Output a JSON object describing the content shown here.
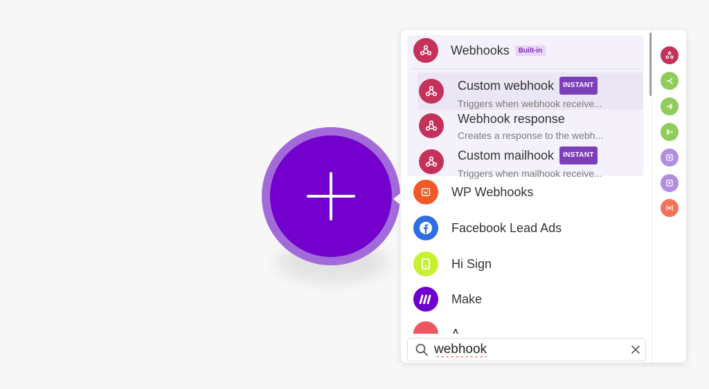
{
  "search": {
    "value": "webhook",
    "placeholder": ""
  },
  "group": {
    "name": "Webhooks",
    "badge": "Built-in",
    "color": "#c4325c",
    "modules": [
      {
        "title": "Custom webhook",
        "badge": "INSTANT",
        "description": "Triggers when webhook receive..."
      },
      {
        "title": "Webhook response",
        "badge": "",
        "description": "Creates a response to the webh..."
      },
      {
        "title": "Custom mailhook",
        "badge": "INSTANT",
        "description": "Triggers when mailhook receive..."
      }
    ]
  },
  "apps": [
    {
      "name": "WP Webhooks",
      "color": "#f05a28",
      "icon": "wp-webhooks-icon"
    },
    {
      "name": "Facebook Lead Ads",
      "color": "#2d6fe0",
      "icon": "facebook-icon"
    },
    {
      "name": "Hi Sign",
      "color": "#c6f132",
      "icon": "hi-sign-icon"
    },
    {
      "name": "Make",
      "color": "#6d00cc",
      "icon": "make-icon"
    },
    {
      "name": "A...",
      "color": "#ef5561",
      "icon": "app-icon"
    }
  ],
  "sidebar": [
    {
      "icon": "webhook-icon",
      "color": "#c4325c"
    },
    {
      "icon": "router-icon",
      "color": "#8fcc5a"
    },
    {
      "icon": "iterator-icon",
      "color": "#8fcc5a"
    },
    {
      "icon": "aggregator-icon",
      "color": "#8fcc5a"
    },
    {
      "icon": "import-icon",
      "color": "#b28ee0"
    },
    {
      "icon": "export-icon",
      "color": "#b28ee0"
    },
    {
      "icon": "ai-icon",
      "color": "#f5725a"
    }
  ]
}
